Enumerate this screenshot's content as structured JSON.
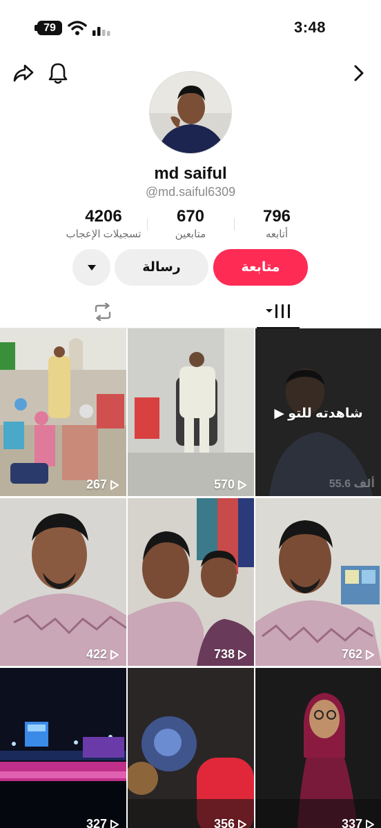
{
  "status_bar": {
    "battery": "79",
    "time": "3:48"
  },
  "nav": {
    "share_icon": "share-icon",
    "bell_icon": "bell-icon",
    "back_icon": "chevron-right-icon"
  },
  "profile": {
    "name": "md saiful",
    "handle": "@md.saiful6309"
  },
  "stats": [
    {
      "value": "4206",
      "label": "تسجيلات الإعجاب"
    },
    {
      "value": "670",
      "label": "متابعين"
    },
    {
      "value": "796",
      "label": "أتابعه"
    }
  ],
  "actions": {
    "follow": "متابعة",
    "message": "رسالة",
    "more_icon": "caret-down-icon"
  },
  "tabs": {
    "videos_icon": "grid-icon",
    "reposts_icon": "repost-icon"
  },
  "colors": {
    "accent": "#fe2c55",
    "button_gray": "#efefef"
  },
  "videos": [
    {
      "views": "267"
    },
    {
      "views": "570"
    },
    {
      "views": "55.6 ألف",
      "overlay": "شاهدته للتو"
    },
    {
      "views": "422"
    },
    {
      "views": "738"
    },
    {
      "views": "762"
    },
    {
      "views": "327"
    },
    {
      "views": "356"
    },
    {
      "views": "337"
    }
  ]
}
